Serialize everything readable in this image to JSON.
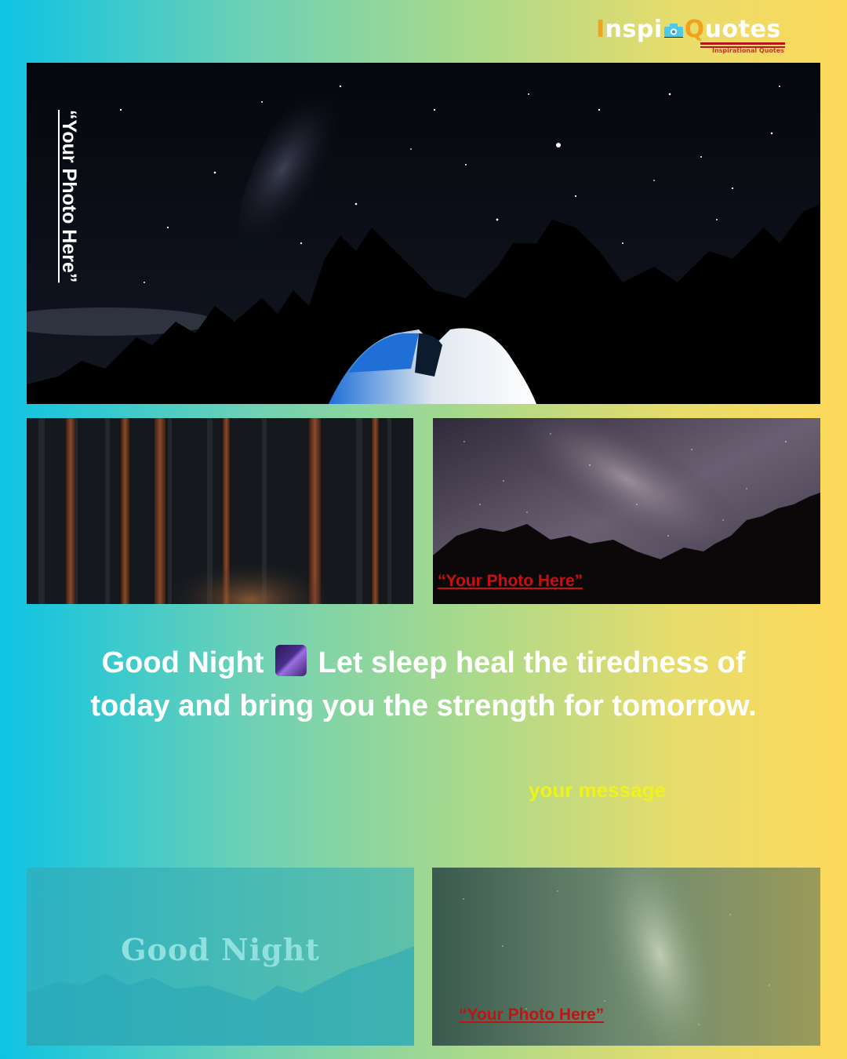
{
  "logo": {
    "first_letter": "I",
    "name_part1": "nspi",
    "name_part2": "Quotes",
    "tagline": "Inspirational Quotes",
    "camera_icon": "camera-icon"
  },
  "panels": {
    "top_label": "“Your Photo Here”",
    "mountain_label": "“Your Photo Here”",
    "milkyway_label": "“Your Photo Here”",
    "good_night_overlay": "Good Night"
  },
  "quote": {
    "before_emoji": "Good Night",
    "emoji": "milky-way-icon",
    "after_emoji": "Let sleep heal the tiredness of today and bring you the strength for tomorrow."
  },
  "message": "your message",
  "colors": {
    "gradient_left": "#0ec3e3",
    "gradient_right": "#fdd95a",
    "label_red": "#c41212",
    "message_yellow": "#f0f21c",
    "logo_orange": "#f2a31b"
  }
}
